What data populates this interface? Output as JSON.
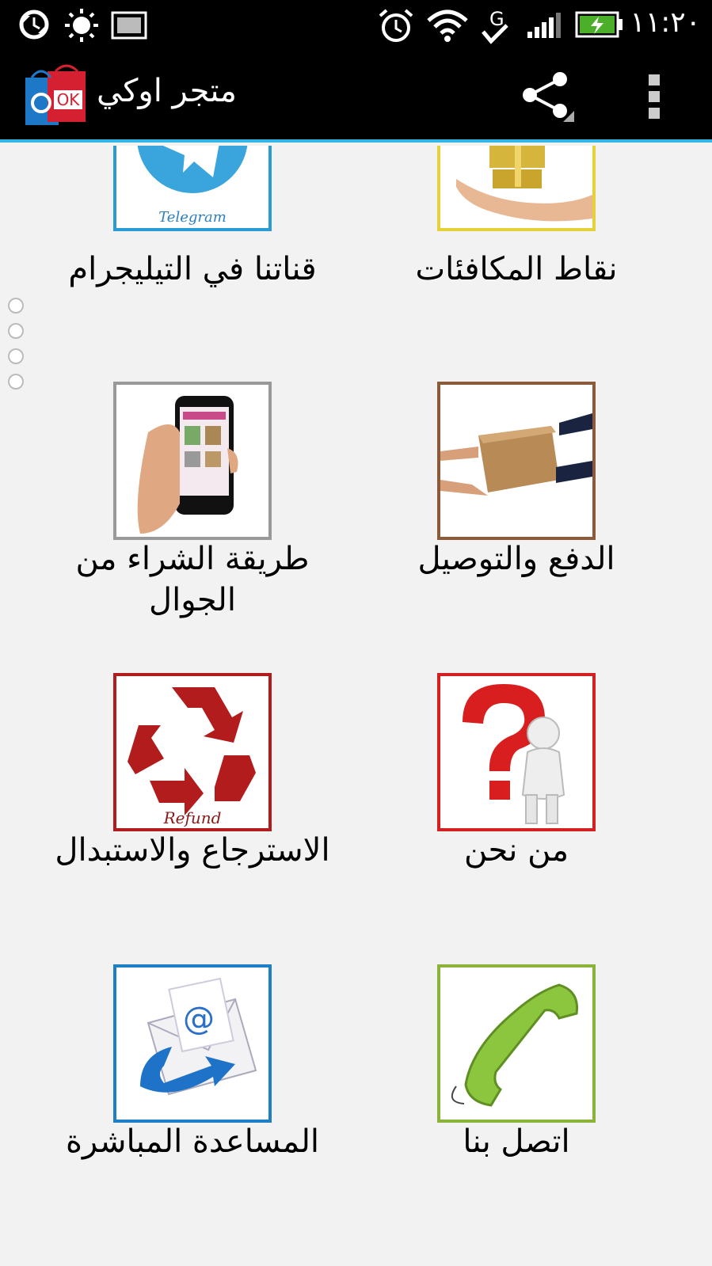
{
  "status_bar": {
    "time": "١١:٢٠",
    "icons": [
      "sync-icon",
      "brightness-icon",
      "image-icon",
      "alarm-icon",
      "wifi-icon",
      "g-check-icon",
      "signal-icon",
      "battery-charging-icon"
    ]
  },
  "action_bar": {
    "title": "متجر اوكي",
    "logo_text": "OK",
    "share_icon": "share-icon",
    "overflow_icon": "overflow-menu-icon"
  },
  "grid": {
    "items": [
      {
        "label": "نقاط المكافئات",
        "icon": "gift-hand-icon",
        "border": "#e5d23a"
      },
      {
        "label": "قناتنا في التيليجرام",
        "icon": "telegram-icon",
        "icon_text": "Telegram",
        "border": "#2b9bd6"
      },
      {
        "label": "الدفع والتوصيل",
        "icon": "delivery-box-icon",
        "border": "#8a5a3a"
      },
      {
        "label": "طريقة الشراء من الجوال",
        "icon": "mobile-phone-icon",
        "border": "#999999"
      },
      {
        "label": "من نحن",
        "icon": "question-person-icon",
        "border": "#d42020"
      },
      {
        "label": "الاسترجاع والاستبدال",
        "icon": "recycle-refund-icon",
        "icon_text": "Refund",
        "border": "#b21c1c"
      },
      {
        "label": "اتصل بنا",
        "icon": "phone-icon",
        "border": "#8bb33a"
      },
      {
        "label": "المساعدة المباشرة",
        "icon": "email-support-icon",
        "icon_text": "@",
        "border": "#1e7fc4"
      }
    ]
  }
}
